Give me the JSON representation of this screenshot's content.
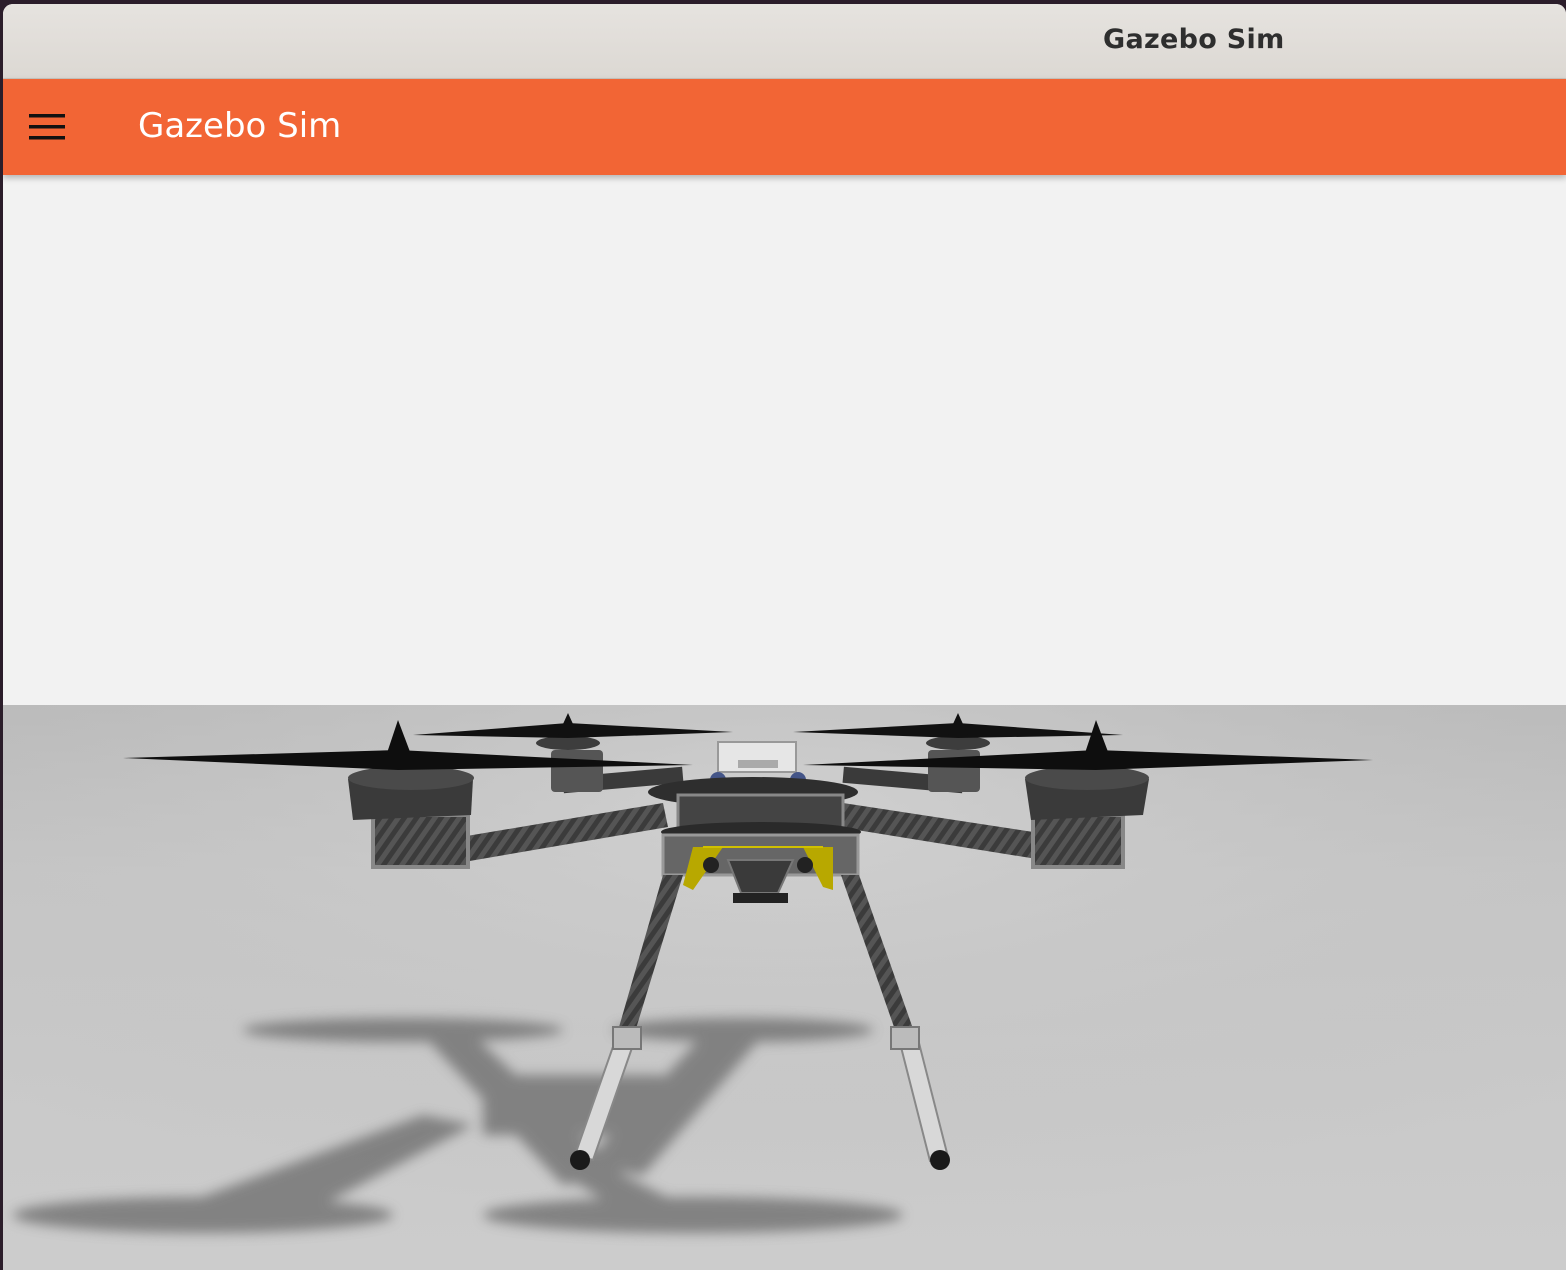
{
  "window": {
    "title": "Gazebo Sim"
  },
  "appbar": {
    "title": "Gazebo Sim",
    "menu_icon": "hamburger-menu-icon",
    "color": "#f26535"
  },
  "scene": {
    "sky_color": "#f2f2f2",
    "ground_color": "#c8c8c8",
    "model": "quadcopter-drone"
  }
}
